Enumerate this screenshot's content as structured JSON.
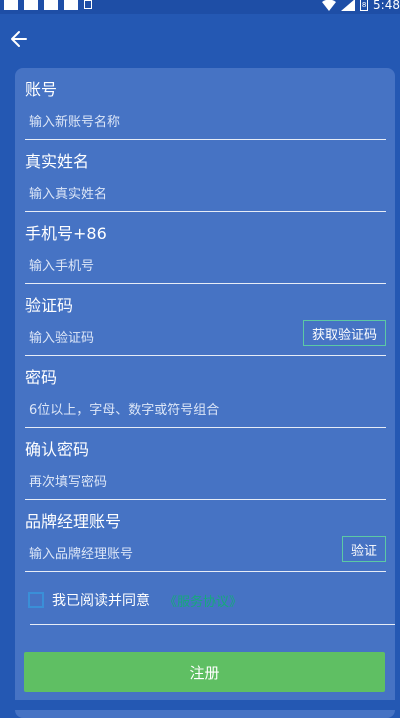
{
  "status_bar": {
    "time": "5:48",
    "battery": "8"
  },
  "form": {
    "fields": [
      {
        "label": "账号",
        "placeholder": "输入新账号名称"
      },
      {
        "label": "真实姓名",
        "placeholder": "输入真实姓名"
      },
      {
        "label": "手机号+86",
        "placeholder": "输入手机号"
      },
      {
        "label": "验证码",
        "placeholder": "输入验证码",
        "button": "获取验证码"
      },
      {
        "label": "密码",
        "placeholder": "6位以上，字母、数字或符号组合"
      },
      {
        "label": "确认密码",
        "placeholder": "再次填写密码"
      },
      {
        "label": "品牌经理账号",
        "placeholder": "输入品牌经理账号",
        "button": "验证"
      }
    ],
    "agree_text": "我已阅读并同意",
    "agreement_link": "《服务协议》",
    "submit_label": "注册"
  },
  "colors": {
    "background": "#2458b3",
    "card": "#4673c4",
    "submit": "#5fbf63",
    "link": "#16a97b"
  }
}
